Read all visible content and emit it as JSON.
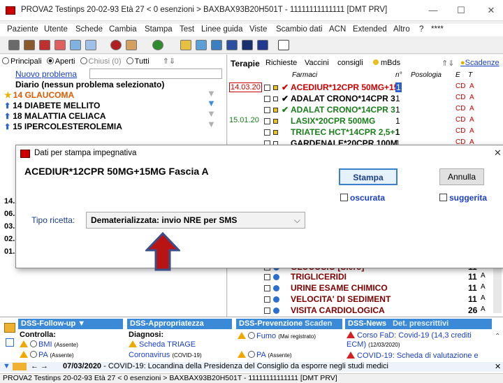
{
  "title": "PROVA2 Testinps  20-02-93  Età 27  < 0 esenzioni >  BAXBAX93B20H501T - 11111111111111  [DMT PRV]",
  "window": {
    "minimize": "—",
    "maximize": "☐",
    "close": "✕"
  },
  "menu": [
    "Paziente",
    "Utente",
    "Schede",
    "Cambia",
    "Stampa",
    "Test",
    "Linee guida",
    "Viste",
    "Scambio dati",
    "ACN",
    "Extended",
    "Altro",
    "?",
    "****"
  ],
  "left": {
    "filters": {
      "principali": "Principali",
      "aperti": "Aperti",
      "chiusi": "Chiusi (0)",
      "tutti": "Tutti"
    },
    "new_problem": "Nuovo problema",
    "diary": "Diario (nessun problema selezionato)",
    "problems": [
      {
        "code": "14",
        "name": "GLAUCOMA",
        "color": "#e05a00"
      },
      {
        "code": "14",
        "name": "DIABETE MELLITO",
        "color": "#000000"
      },
      {
        "code": "18",
        "name": "MALATTIA CELIACA",
        "color": "#000000"
      },
      {
        "code": "15",
        "name": "IPERCOLESTEROLEMIA",
        "color": "#000000"
      }
    ],
    "side_rows": [
      "14.",
      "06.",
      "03.",
      "02.",
      "01."
    ]
  },
  "tabs": {
    "terapie": "Terapie",
    "richieste": "Richieste",
    "vaccini": "Vaccini",
    "consigli": "consigli",
    "mbds": "mBds",
    "scadenze": "Scadenze"
  },
  "therapy_header": {
    "farmaci": "Farmaci",
    "n": "n°",
    "posologia": "Posologia",
    "e": "E",
    "t": "T"
  },
  "drugs": [
    {
      "date": "14.03.20",
      "check": "✔",
      "name": "ACEDIUR*12CPR 50MG+15",
      "n": "1",
      "e": "CD",
      "t": "A",
      "color": "#cc0000"
    },
    {
      "date": "",
      "check": "✔",
      "name": "ADALAT CRONO*14CPR 3",
      "n": "1",
      "e": "CD",
      "t": "A",
      "color": "#000000"
    },
    {
      "date": "",
      "check": "✔",
      "name": "ADALAT CRONO*14CPR 3",
      "n": "1",
      "e": "CD",
      "t": "A",
      "color": "#1a7f1a"
    },
    {
      "date": "15.01.20",
      "check": "",
      "name": "LASIX*20CPR 500MG",
      "n": "1",
      "e": "CD",
      "t": "A",
      "color": "#1a7f1a"
    },
    {
      "date": "",
      "check": "",
      "name": "TRIATEC HCT*14CPR 2,5+1",
      "n": "1",
      "e": "CD",
      "t": "A",
      "color": "#1a7f1a"
    },
    {
      "date": "",
      "check": "",
      "name": "GARDENALE*20CPR 100M",
      "n": "1",
      "e": "CD",
      "t": "A",
      "color": "#000000"
    }
  ],
  "requests": [
    {
      "name": "GLUCOSIO [Siero]",
      "n": "11",
      "t": "A"
    },
    {
      "name": "TRIGLICERIDI",
      "n": "11",
      "t": "A"
    },
    {
      "name": "URINE ESAME CHIMICO",
      "n": "11",
      "t": "A"
    },
    {
      "name": "VELOCITA' DI SEDIMENT",
      "n": "11",
      "t": "A"
    },
    {
      "name": "VISITA CARDIOLOGICA",
      "n": "26",
      "t": "A"
    }
  ],
  "dialog": {
    "title": "Dati per stampa impegnativa",
    "drug": "ACEDIUR*12CPR 50MG+15MG Fascia A",
    "stampa": "Stampa",
    "annulla": "Annulla",
    "oscurata": "oscurata",
    "suggerita": "suggerita",
    "tipo_label": "Tipo ricetta:",
    "tipo_value": "Dematerializzata: invio NRE per SMS"
  },
  "dss": {
    "followup": {
      "header": "DSS-Follow-up",
      "controlla": "Controlla:",
      "items": [
        "BMI",
        "PA"
      ],
      "absent": "(Assente)"
    },
    "appropriatezza": {
      "header": "DSS-Appropriatezza",
      "diagnosi": "Diagnosi:",
      "items": [
        "Scheda TRIAGE",
        "Coronavirus"
      ],
      "cov": "(COVID-19)"
    },
    "prevenzione": {
      "header": "DSS-Prevenzione",
      "scaden": "Scaden",
      "items": [
        "Fumo",
        "PA"
      ],
      "mai": "(Mai registrato)",
      "absent": "(Assente)"
    },
    "news": {
      "header": "DSS-News",
      "det": "Det. prescrittivi",
      "item1": "Corso FaD: Covid-19 (14,3 crediti ECM)",
      "date1": "(12/03/2020)",
      "item2": "COVID-19: Scheda di valutazione e"
    }
  },
  "ticker": {
    "date": "07/03/2020",
    "text": " - COVID-19: Locandina della Presidenza del Consiglio da esporre negli studi medici"
  },
  "status": "PROVA2 Testinps  20-02-93  Età 27  < 0 esenzioni >  BAXBAX93B20H501T - 11111111111111  [DMT PRV]"
}
